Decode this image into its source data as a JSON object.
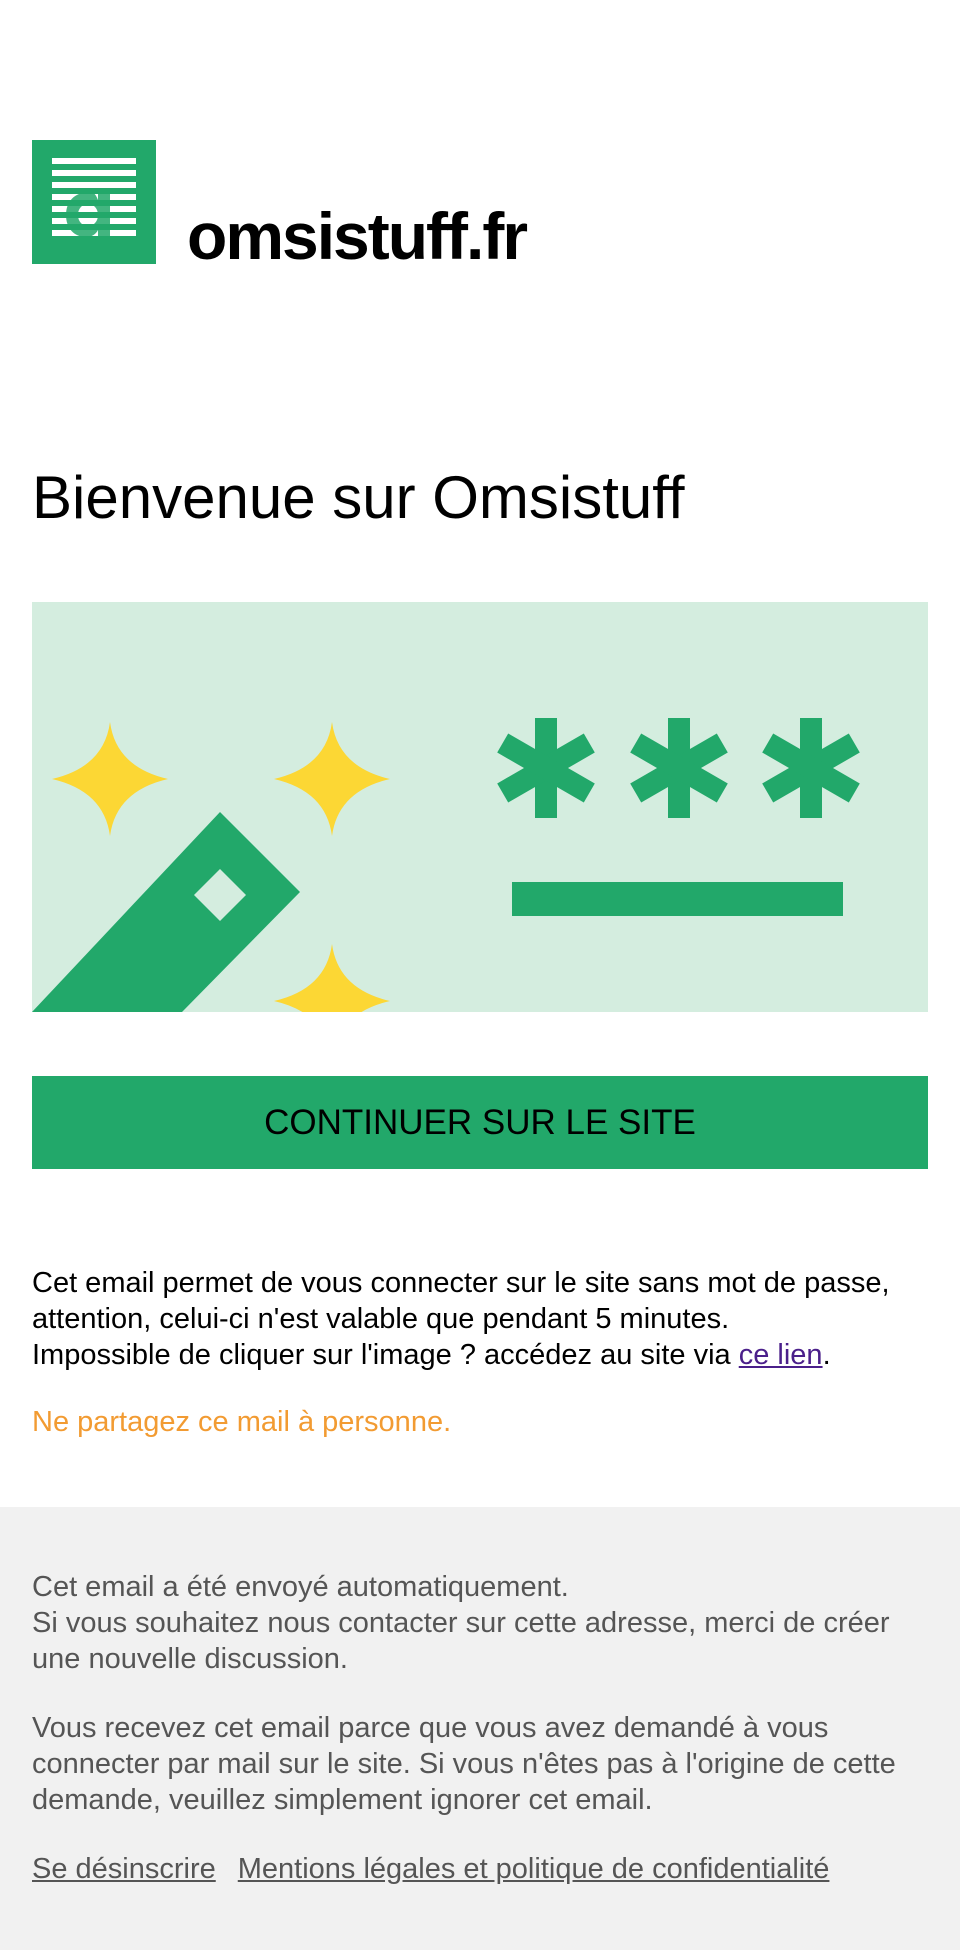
{
  "header": {
    "brand_name": "omsistuff.fr",
    "logo_icon": "omsistuff-logo-icon"
  },
  "title": "Bienvenue sur Omsistuff",
  "hero": {
    "illustration": "password-and-magic-key-illustration",
    "colors": {
      "background": "#d4eddf",
      "accent": "#22a86a",
      "sparkle": "#fcd734"
    }
  },
  "cta": {
    "label": "CONTINUER SUR LE SITE",
    "color": "#22a86a"
  },
  "body": {
    "line1": "Cet email permet de vous connecter sur le site sans mot de passe, attention, celui-ci n'est valable que pendant 5 minutes.",
    "line2_prefix": "Impossible de cliquer sur l'image ? accédez au site via ",
    "link_label": "ce lien",
    "line2_suffix": ".",
    "warning": "Ne partagez ce mail à personne.",
    "warning_color": "#f29b32"
  },
  "footer": {
    "auto_line": "Cet email a été envoyé automatiquement.",
    "contact_line": "Si vous souhaitez nous contacter sur cette adresse, merci de créer une nouvelle discussion.",
    "reason": "Vous recevez cet email parce que vous avez demandé à vous connecter par mail sur le site. Si vous n'êtes pas à l'origine de cette demande, veuillez simplement ignorer cet email.",
    "unsubscribe_label": "Se désinscrire",
    "legal_label": "Mentions légales et politique de confidentialité"
  }
}
